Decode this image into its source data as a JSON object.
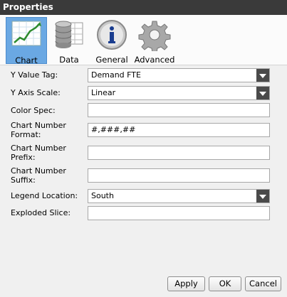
{
  "window": {
    "title": "Properties"
  },
  "tabs": [
    {
      "label": "Chart",
      "icon": "chart-icon",
      "active": true
    },
    {
      "label": "Data",
      "icon": "database-icon",
      "active": false
    },
    {
      "label": "General",
      "icon": "info-icon",
      "active": false
    },
    {
      "label": "Advanced",
      "icon": "gear-icon",
      "active": false
    }
  ],
  "fields": [
    {
      "label": "Y Value Tag:",
      "value": "Demand FTE",
      "type": "select"
    },
    {
      "label": "Y Axis Scale:",
      "value": "Linear",
      "type": "select"
    },
    {
      "label": "Color Spec:",
      "value": "",
      "type": "text"
    },
    {
      "label": "Chart Number Format:",
      "value": "#,###,##",
      "type": "text"
    },
    {
      "label": "Chart Number Prefix:",
      "value": "",
      "type": "text"
    },
    {
      "label": "Chart Number Suffix:",
      "value": "",
      "type": "text"
    },
    {
      "label": "Legend Location:",
      "value": "South",
      "type": "select"
    },
    {
      "label": "Exploded Slice:",
      "value": "",
      "type": "text"
    }
  ],
  "buttons": {
    "apply": "Apply",
    "ok": "OK",
    "cancel": "Cancel"
  },
  "colors": {
    "titlebar": "#3a3a3a",
    "active_tab": "#6aa8e3",
    "dropdown_arrow": "#4a4a4a"
  }
}
